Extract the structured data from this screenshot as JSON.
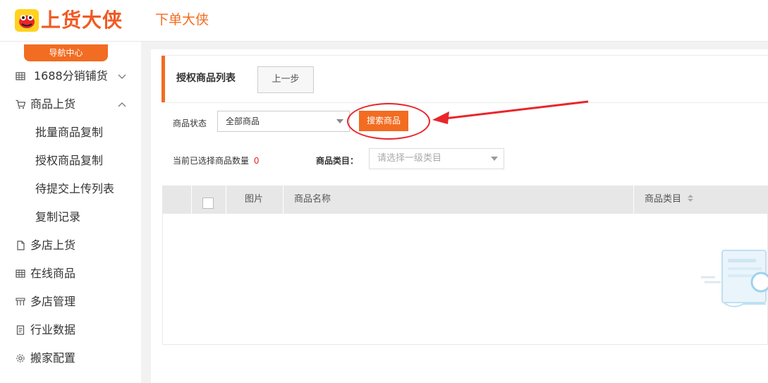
{
  "header": {
    "logo_text": "上货大侠",
    "top_nav_label": "下单大侠"
  },
  "sidebar": {
    "nav_center": "导航中心",
    "items": [
      {
        "label": "1688分销铺货",
        "icon": "grid-icon",
        "expanded": false
      },
      {
        "label": "商品上货",
        "icon": "cart-icon",
        "expanded": true,
        "children": [
          "批量商品复制",
          "授权商品复制",
          "待提交上传列表",
          "复制记录"
        ]
      },
      {
        "label": "多店上货",
        "icon": "file-icon"
      },
      {
        "label": "在线商品",
        "icon": "grid-icon"
      },
      {
        "label": "多店管理",
        "icon": "stores-icon"
      },
      {
        "label": "行业数据",
        "icon": "document-icon"
      },
      {
        "label": "搬家配置",
        "icon": "gear-icon"
      }
    ]
  },
  "main": {
    "panel_title": "授权商品列表",
    "back_button": "上一步",
    "status_label": "商品状态",
    "status_select_value": "全部商品",
    "search_button": "搜索商品",
    "selected_count_label": "当前已选择商品数量",
    "selected_count": "0",
    "category_label": "商品类目：",
    "category_placeholder": "请选择一级类目",
    "table_headers": [
      "图片",
      "商品名称",
      "商品类目"
    ]
  },
  "colors": {
    "brand": "#f26c21",
    "annotation": "#e8262b"
  }
}
